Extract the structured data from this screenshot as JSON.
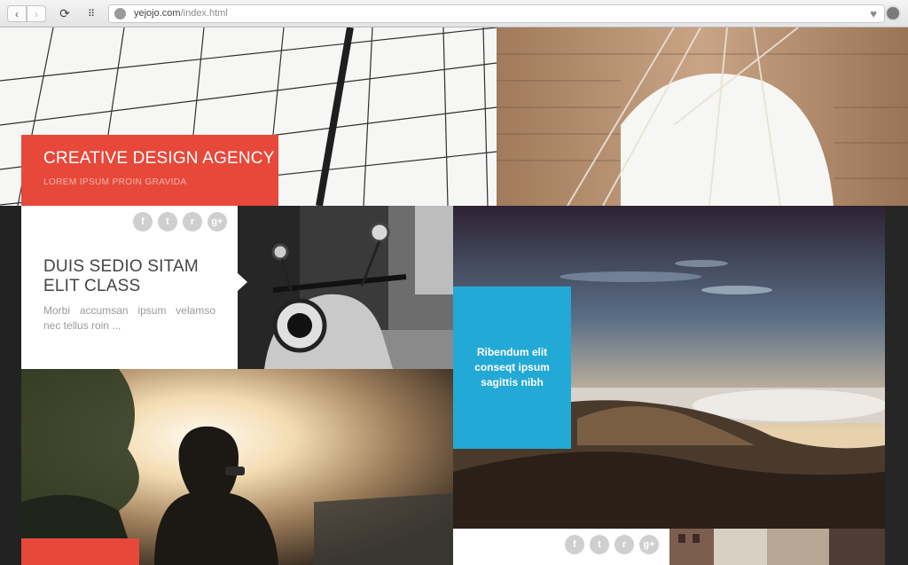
{
  "browser": {
    "url_host": "yejojo.com",
    "url_path": "/index.html",
    "back_icon": "‹",
    "forward_icon": "›",
    "reload_icon": "⟳",
    "apps_icon": "⠿",
    "heart_icon": "♥"
  },
  "hero": {
    "title": "CREATIVE DESIGN AGENCY",
    "subtitle": "LOREM IPSUM PROIN GRAVIDA"
  },
  "post1": {
    "social": [
      "f",
      "t",
      "r",
      "g+"
    ],
    "title": "DUIS SEDIO SITAM ELIT CLASS",
    "excerpt": "Morbi accumsan ipsum velamso nec tellus roin ..."
  },
  "feature": {
    "text": "Ribendum elit conseqt ipsum sagittis nibh"
  },
  "post2": {
    "social": [
      "f",
      "t",
      "r",
      "g+"
    ]
  },
  "colors": {
    "accent_red": "#e7483a",
    "accent_blue": "#23a9d5"
  }
}
